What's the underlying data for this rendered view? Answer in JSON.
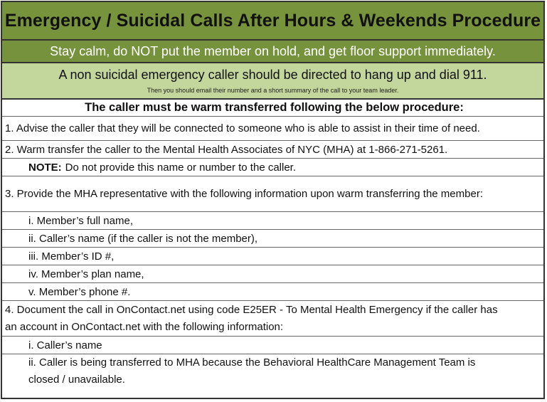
{
  "title": "Emergency / Suicidal Calls After Hours & Weekends Procedure",
  "calm_banner": "Stay calm, do NOT put the member on hold, and get floor support immediately.",
  "non_suicidal": {
    "main": "A non suicidal emergency caller should be directed to hang up and dial 911.",
    "sub": "Then you should email their number and a short summary of the call to your team leader."
  },
  "procedure_heading": "The caller must be warm transferred following the below procedure:",
  "steps": {
    "step1": "1. Advise the caller that they will be connected to someone who is able to assist in their time of need.",
    "step2": "2. Warm transfer the caller to the Mental Health Associates of NYC (MHA) at 1-866-271-5261.",
    "note_label": "NOTE:",
    "note_text": "Do not provide this name or number to the caller.",
    "step3": "3. Provide the MHA representative with the following information upon warm transferring the member:",
    "step3_items": [
      "i. Member’s full name,",
      "ii. Caller’s name (if the caller is not the member),",
      "iii. Member’s ID #,",
      "iv. Member’s plan name,",
      "v. Member’s phone #."
    ],
    "step4_line1": "4. Document the call in OnContact.net using code E25ER - To Mental Health Emergency if the caller has",
    "step4_line2": "an account in OnContact.net with the following information:",
    "step4_items": [
      "i. Caller’s name",
      "ii. Caller is being transferred to MHA because the Behavioral HealthCare Management Team is",
      "closed / unavailable."
    ]
  }
}
